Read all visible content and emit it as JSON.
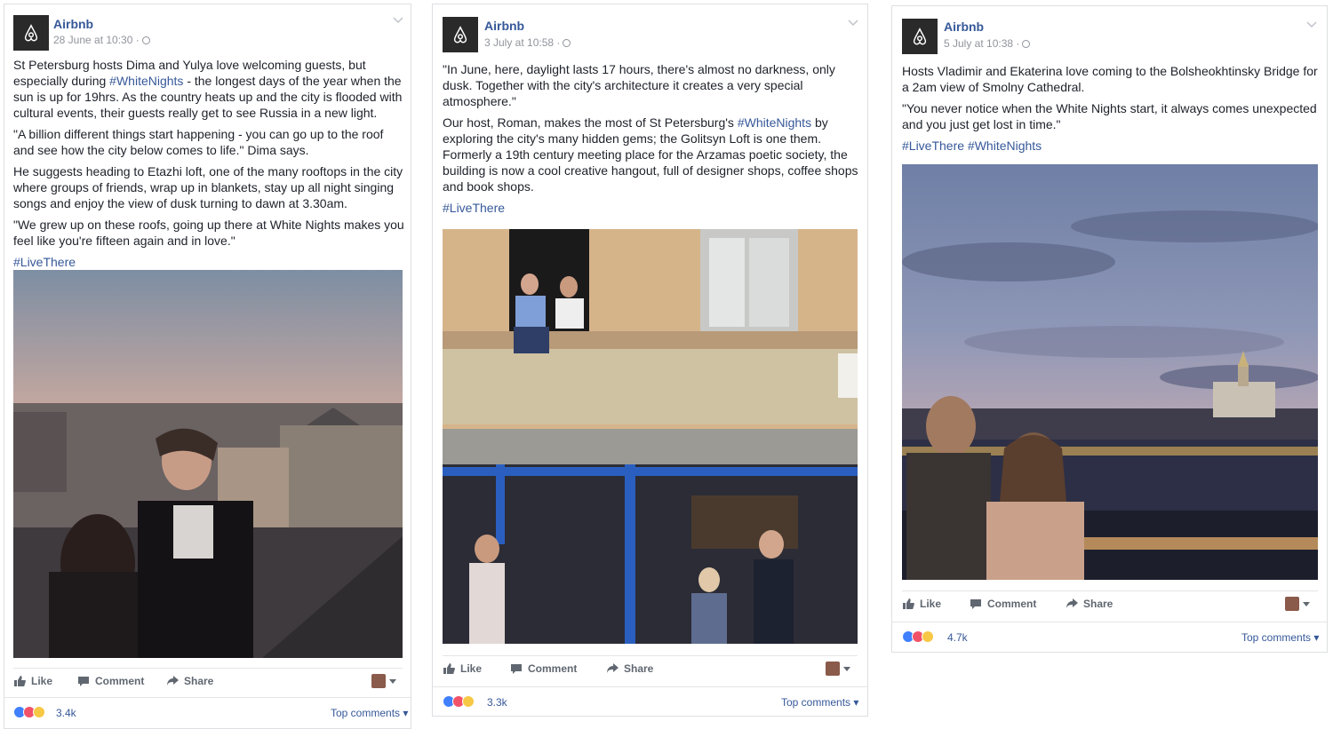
{
  "colors": {
    "link": "#365899",
    "meta": "#90949c",
    "text": "#1d2129",
    "action": "#606770"
  },
  "posts": [
    {
      "author": "Airbnb",
      "timestamp": "28 June at 10:30 ·",
      "paragraphs": [
        [
          "St Petersburg hosts Dima and Yulya love welcoming guests, but especially during ",
          "#WhiteNights",
          " - the longest days of the year when the sun is up for 19hrs. As the country heats up and the city is flooded with cultural events, their guests really get to see Russia in a new light."
        ],
        [
          "\"A billion different things start happening - you can go up to the roof and see how the city below comes to life.\" Dima says."
        ],
        [
          "He suggests heading to Etazhi loft, one of the many rooftops in the city where groups of friends, wrap up in blankets, stay up all night singing songs and enjoy the view of dusk turning to dawn at 3.30am."
        ],
        [
          "\"We grew up on these roofs, going up there at White Nights makes you feel like you're fifteen again and in love.\""
        ]
      ],
      "hashtags": "#LiveThere",
      "actions": {
        "like": "Like",
        "comment": "Comment",
        "share": "Share"
      },
      "reaction_count": "3.4k",
      "top_comments": "Top comments"
    },
    {
      "author": "Airbnb",
      "timestamp": "3 July at 10:58 ·",
      "paragraphs": [
        [
          "\"In June, here, daylight lasts 17 hours, there's almost no darkness, only dusk. Together with the city's architecture it creates a very special atmosphere.\""
        ],
        [
          "Our host, Roman, makes the most of St Petersburg's ",
          "#WhiteNights",
          " by exploring the city's many hidden gems; the Golitsyn Loft is one them. Formerly a 19th century meeting place for the Arzamas poetic society, the building is now a cool creative hangout, full of designer shops, coffee shops and book shops."
        ]
      ],
      "hashtags": "#LiveThere",
      "actions": {
        "like": "Like",
        "comment": "Comment",
        "share": "Share"
      },
      "reaction_count": "3.3k",
      "top_comments": "Top comments"
    },
    {
      "author": "Airbnb",
      "timestamp": "5 July at 10:38 ·",
      "paragraphs": [
        [
          "Hosts Vladimir and Ekaterina love coming to the Bolsheokhtinsky Bridge for a 2am view of Smolny Cathedral."
        ],
        [
          "\"You never notice when the White Nights start, it always comes unexpected and you just get lost in time.\""
        ]
      ],
      "hashtags": "#LiveThere #WhiteNights",
      "actions": {
        "like": "Like",
        "comment": "Comment",
        "share": "Share"
      },
      "reaction_count": "4.7k",
      "top_comments": "Top comments"
    }
  ]
}
